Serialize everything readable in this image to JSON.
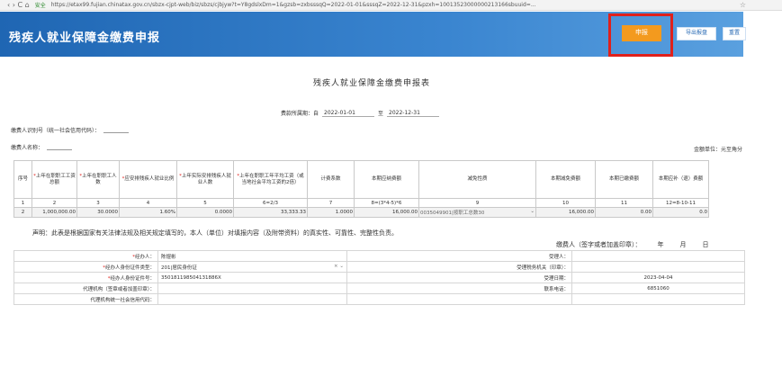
{
  "browser": {
    "nav": "‹ › C ⌂",
    "secure": "安全",
    "url": "https://etax99.fujian.chinatax.gov.cn/sbzx-cjpt-web/biz/sbzs/cjbjyw?t=Y8gdslxDm=1&gzsb=zxbsssqQ=2022-01-01&sssqZ=2022-12-31&pzxh=10013523000000213166sbuuid=..."
  },
  "header": {
    "title": "残疾人就业保障金缴费申报",
    "declare_button": "申报",
    "export_button": "导出报盘",
    "reset_button": "重置"
  },
  "form": {
    "title": "残疾人就业保障金缴费申报表",
    "period_label": "费款所属期：自",
    "period_from": "2022-01-01",
    "period_to_label": "至",
    "period_to": "2022-12-31",
    "payer_id_label": "缴费人识别号（统一社会信用代码）：",
    "payer_name_label": "缴费人名称：",
    "unit_label": "金额单位：元至角分"
  },
  "table": {
    "headers": [
      {
        "req": "",
        "text": "序号"
      },
      {
        "req": "*",
        "text": "上年在职职工工资总额"
      },
      {
        "req": "*",
        "text": "上年在职职工人数"
      },
      {
        "req": "*",
        "text": "应安排残疾人就业比例"
      },
      {
        "req": "*",
        "text": "上年实际安排残疾人就业人数"
      },
      {
        "req": "*",
        "text": "上年在职职工年平均工资（或当地社会平均工资的2倍）"
      },
      {
        "req": "",
        "text": "计费系数"
      },
      {
        "req": "",
        "text": "本期应纳费额"
      },
      {
        "req": "",
        "text": "减免性质"
      },
      {
        "req": "",
        "text": "本期减免费额"
      },
      {
        "req": "",
        "text": "本期已缴费额"
      },
      {
        "req": "",
        "text": "本期应补（退）费额"
      }
    ],
    "numbers": [
      "1",
      "2",
      "3",
      "4",
      "5",
      "6=2/3",
      "7",
      "8=(3*4-5)*6",
      "9",
      "10",
      "11",
      "12=8-10-11"
    ],
    "row": [
      "2",
      "1,000,000.00",
      "30.0000",
      "1.60%",
      "0.0000",
      "33,333.33",
      "1.0000",
      "16,000.00",
      "0035049901|按职工总数30",
      "16,000.00",
      "0.00",
      "0.0"
    ]
  },
  "declaration": "声明：此表是根据国家有关法律法规及相关规定填写的，本人（单位）对填报内容（及附带资料）的真实性、可靠性、完整性负责。",
  "signature": {
    "label": "缴费人（签字或者加盖印章）：",
    "year": "年",
    "month": "月",
    "day": "日"
  },
  "bottom": {
    "handler_label": "经办人：",
    "handler_value": "陈煜彬",
    "id_type_label": "经办人身份证件类型：",
    "id_type_value": "201|居民身份证",
    "id_no_label": "经办人身份证件号：",
    "id_no_value": "350181198504131886X",
    "agent_label": "代理机构（签章或者加盖印章）：",
    "agent_code_label": "代理机构统一社会信用代码：",
    "accepter_label": "受理人：",
    "tax_office_label": "受理税务机关（印章）：",
    "accept_date_label": "受理日期：",
    "accept_date_value": "2023-04-04",
    "phone_label": "联系电话：",
    "phone_value": "6851060"
  }
}
